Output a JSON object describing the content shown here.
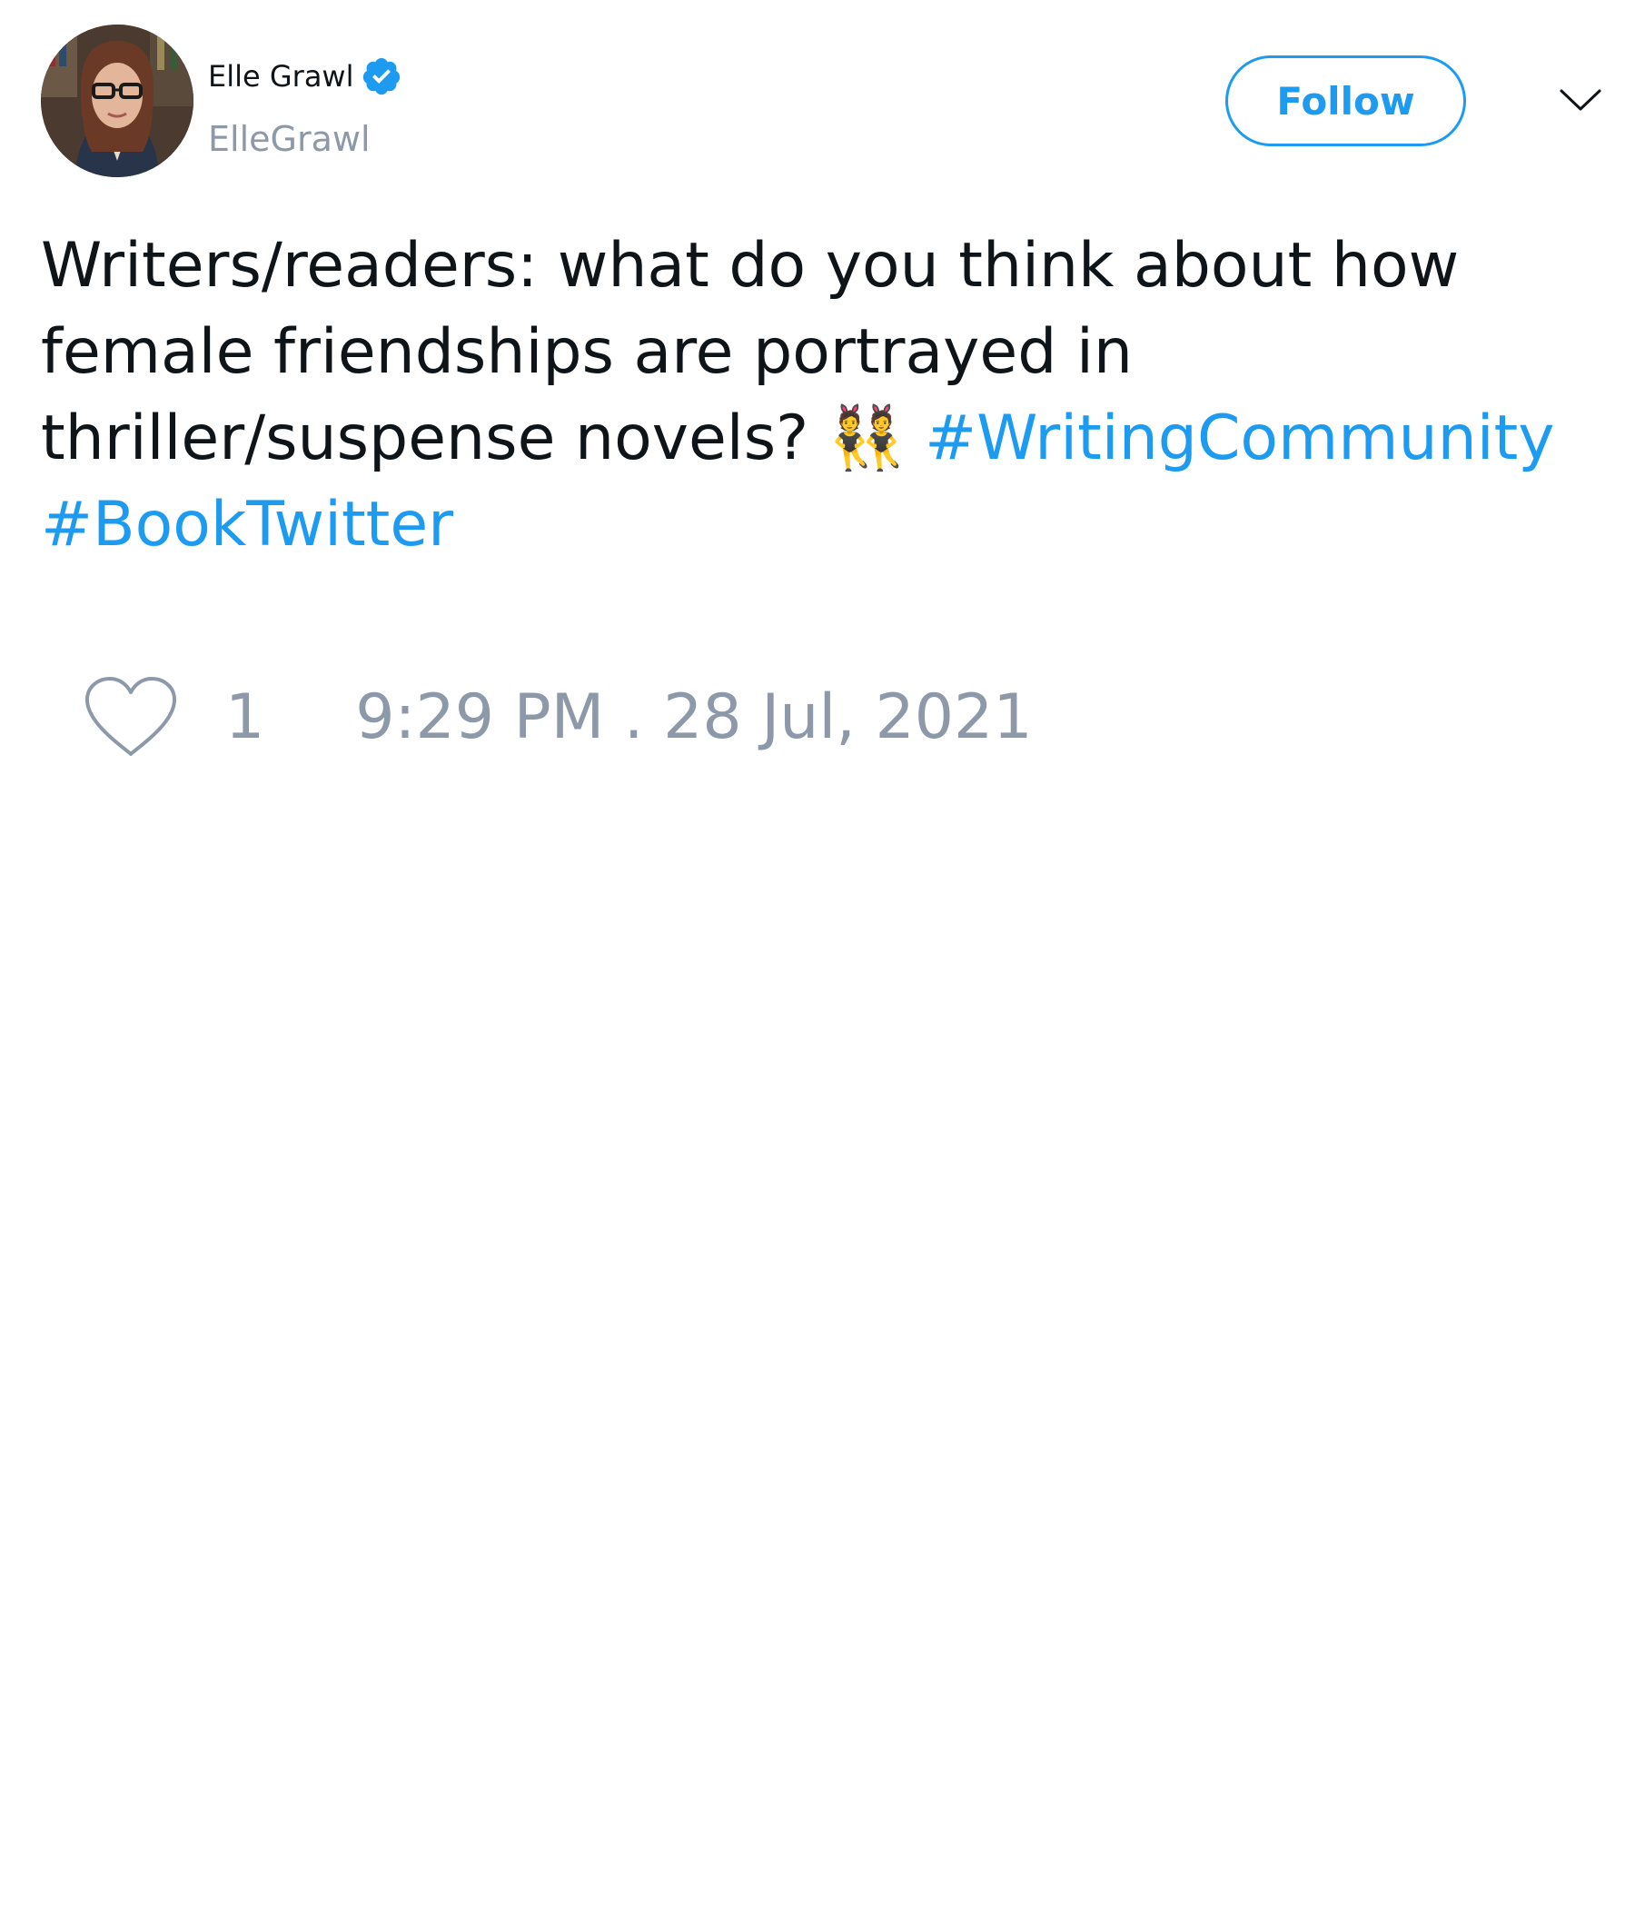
{
  "user": {
    "display_name": "Elle Grawl",
    "handle": "ElleGrawl",
    "verified": true,
    "avatar_icon": "profile-photo"
  },
  "actions": {
    "follow_label": "Follow",
    "menu_icon": "chevron-down-icon"
  },
  "tweet": {
    "text_before": "Writers/readers: what do you think about how female friendships are portrayed in thriller/suspense novels? 👯 ",
    "hashtags": [
      "#WritingCommunity",
      "#BookTwitter"
    ]
  },
  "footer": {
    "like_icon": "heart-icon",
    "like_count": "1",
    "timestamp": "9:29 PM . 28 Jul, 2021"
  },
  "colors": {
    "accent": "#1d9bf0",
    "muted": "#8d99a8",
    "text": "#0f1419"
  }
}
